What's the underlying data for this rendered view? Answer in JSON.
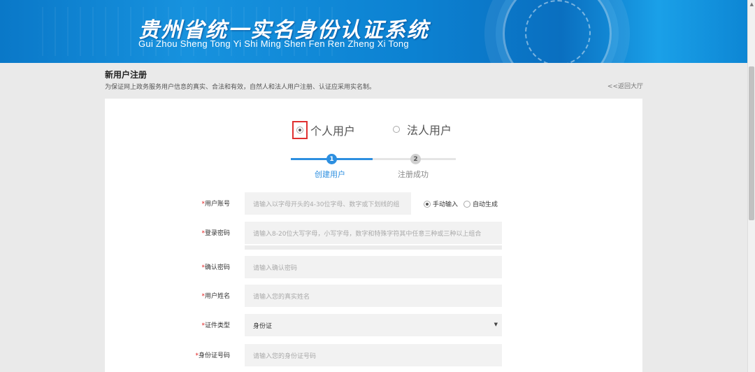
{
  "header": {
    "title": "贵州省统一实名身份认证系统",
    "subtitle": "Gui Zhou Sheng Tong Yi Shi Ming Shen Fen Ren Zheng Xi Tong"
  },
  "page": {
    "title": "新用户注册",
    "description": "为保证网上政务服务用户信息的真实、合法和有效，自然人和法人用户注册、认证应采用实名制。",
    "back_link": "<<返回大厅"
  },
  "user_type": {
    "personal": "个人用户",
    "legal": "法人用户",
    "selected": "personal"
  },
  "steps": [
    {
      "number": "1",
      "label": "创建用户",
      "active": true
    },
    {
      "number": "2",
      "label": "注册成功",
      "active": false
    }
  ],
  "form": {
    "account": {
      "label": "用户账号",
      "placeholder": "请输入以字母开头的4-30位字母、数字或下划线的组",
      "mode_manual": "手动输入",
      "mode_auto": "自动生成",
      "mode_selected": "manual"
    },
    "password": {
      "label": "登录密码",
      "placeholder": "请输入8-20位大写字母，小写字母，数字和特殊字符其中任意三种或三种以上组合"
    },
    "confirm_password": {
      "label": "确认密码",
      "placeholder": "请输入确认密码"
    },
    "name": {
      "label": "用户姓名",
      "placeholder": "请输入您的真实姓名"
    },
    "id_type": {
      "label": "证件类型",
      "value": "身份证"
    },
    "id_number": {
      "label": "身份证号码",
      "placeholder": "请输入您的身份证号码"
    },
    "required_mark": "*"
  },
  "colors": {
    "accent": "#2d8fe0",
    "required": "#e02020",
    "banner": "#0a78c8"
  }
}
